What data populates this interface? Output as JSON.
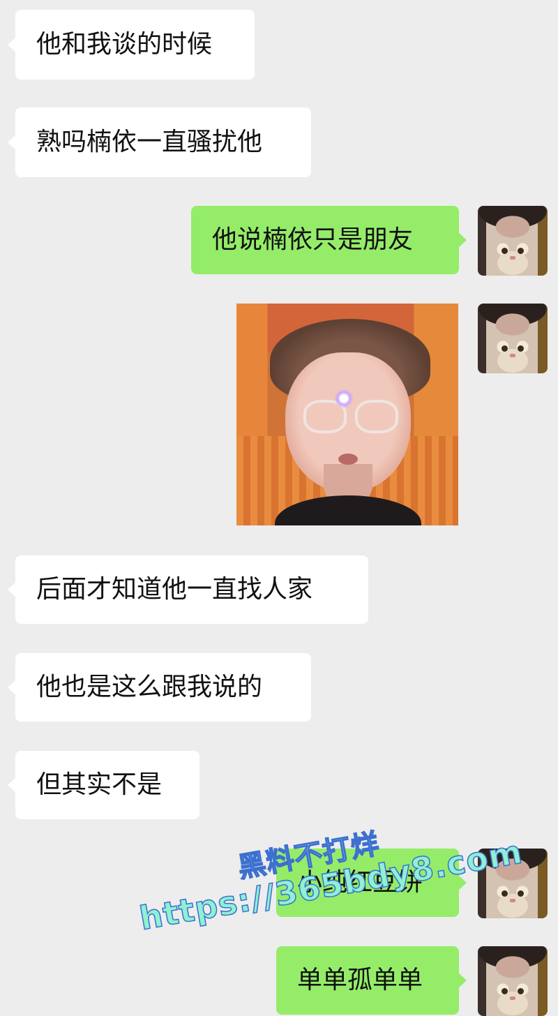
{
  "messages": [
    {
      "side": "left",
      "text": "他和我谈的时候"
    },
    {
      "side": "left",
      "text": "熟吗楠依一直骚扰他"
    },
    {
      "side": "right",
      "text": "他说楠依只是朋友"
    },
    {
      "side": "right",
      "type": "sticker",
      "icon": "meme-face-sticker"
    },
    {
      "side": "left",
      "text": "后面才知道他一直找人家"
    },
    {
      "side": "left",
      "text": "他也是这么跟我说的"
    },
    {
      "side": "left",
      "text": "但其实不是"
    },
    {
      "side": "right",
      "text": "小纯红豆饼"
    },
    {
      "side": "right",
      "text": "单单孤单单"
    }
  ],
  "avatar_icon": "cat-avatar-icon",
  "watermark": {
    "line1": "黑料不打烊",
    "line2": "https://365bdy8.com"
  },
  "colors": {
    "background": "#ededed",
    "left_bubble": "#ffffff",
    "right_bubble": "#95ec69"
  }
}
